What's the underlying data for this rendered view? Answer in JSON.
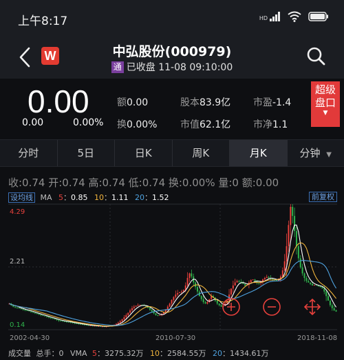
{
  "status": {
    "time": "上午8:17",
    "net": "HD",
    "battery": ""
  },
  "header": {
    "logo": "W",
    "title": "中弘股份(000979)",
    "badge": "通",
    "status_text": "已收盘 11-08 09:10:00"
  },
  "quote": {
    "price": "0.00",
    "change": "0.00",
    "change_pct": "0.00%",
    "items": [
      {
        "label": "额",
        "value": "0.00"
      },
      {
        "label": "股本",
        "value": "83.9亿"
      },
      {
        "label": "市盈",
        "value": "-1.4"
      },
      {
        "label": "换",
        "value": "0.00%"
      },
      {
        "label": "市值",
        "value": "62.1亿"
      },
      {
        "label": "市净",
        "value": "1.1"
      }
    ],
    "level2": {
      "line1": "超级",
      "line2": "盘口"
    }
  },
  "tabs": [
    "分时",
    "5日",
    "日K",
    "周K",
    "月K",
    "分钟"
  ],
  "active_tab": "月K",
  "ohlc": "收:0.74 开:0.74 高:0.74 低:0.74 换:0.00% 量:0 额:0.00",
  "ma": {
    "settings_btn": "设均线",
    "label": "MA",
    "ma5_label": "5",
    "ma5_value": "0.85",
    "ma10_label": "10",
    "ma10_value": "1.11",
    "ma20_label": "20",
    "ma20_value": "1.52",
    "adjust_btn": "前复权"
  },
  "colors": {
    "up": "#e8413c",
    "down": "#2fb24c",
    "ma5": "#ffffff",
    "ma10": "#f0b43c",
    "ma20": "#4fa3e0"
  },
  "chart_data": {
    "type": "candlestick",
    "y_ticks": [
      "4.29",
      "2.21",
      "0.14"
    ],
    "x_ticks": [
      "2002-04-30",
      "2010-07-30",
      "2018-11-08"
    ],
    "ylim": [
      0.14,
      4.29
    ],
    "close": [
      1.0,
      0.95,
      0.9,
      0.88,
      0.86,
      0.84,
      0.82,
      0.8,
      0.78,
      0.77,
      0.75,
      0.72,
      0.7,
      0.68,
      0.66,
      0.64,
      0.62,
      0.6,
      0.58,
      0.56,
      0.54,
      0.52,
      0.5,
      0.48,
      0.46,
      0.44,
      0.43,
      0.42,
      0.41,
      0.4,
      0.39,
      0.38,
      0.36,
      0.35,
      0.34,
      0.33,
      0.32,
      0.31,
      0.3,
      0.29,
      0.28,
      0.28,
      0.27,
      0.27,
      0.26,
      0.26,
      0.25,
      0.25,
      0.24,
      0.25,
      0.26,
      0.27,
      0.28,
      0.3,
      0.33,
      0.37,
      0.42,
      0.48,
      0.55,
      0.62,
      0.7,
      0.78,
      0.85,
      0.9,
      0.93,
      0.95,
      0.96,
      0.95,
      0.93,
      0.9,
      0.86,
      0.8,
      0.74,
      0.68,
      0.62,
      0.6,
      0.62,
      0.66,
      0.72,
      0.8,
      0.9,
      1.0,
      1.12,
      1.22,
      1.3,
      1.35,
      1.38,
      1.4,
      1.45,
      1.6,
      1.85,
      2.0,
      1.9,
      1.7,
      1.55,
      1.4,
      1.25,
      1.15,
      1.05,
      1.0,
      1.05,
      1.15,
      1.25,
      1.2,
      1.1,
      1.0,
      0.95,
      0.9,
      0.92,
      1.0,
      1.1,
      1.3,
      1.5,
      1.6,
      1.7,
      1.75,
      1.72,
      1.68,
      1.65,
      1.6,
      1.62,
      1.7,
      1.78,
      1.8,
      1.75,
      1.7,
      1.68,
      1.72,
      1.8,
      1.85,
      1.88,
      1.85,
      1.82,
      1.8,
      1.78,
      1.76,
      1.8,
      1.9,
      2.1,
      2.4,
      2.9,
      3.6,
      4.2,
      3.9,
      3.4,
      2.9,
      2.5,
      2.2,
      2.0,
      1.85,
      1.75,
      1.7,
      1.65,
      1.6,
      1.62,
      1.6,
      1.58,
      1.55,
      1.5,
      1.4,
      1.25,
      1.1,
      0.95,
      0.85,
      0.78,
      0.74
    ]
  },
  "vma": {
    "label": "成交量",
    "total": "总手：0",
    "vma_label": "VMA",
    "v5_label": "5",
    "v5_value": "3275.32万",
    "v10_label": "10",
    "v10_value": "2584.55万",
    "v20_label": "20",
    "v20_value": "1434.61万"
  }
}
